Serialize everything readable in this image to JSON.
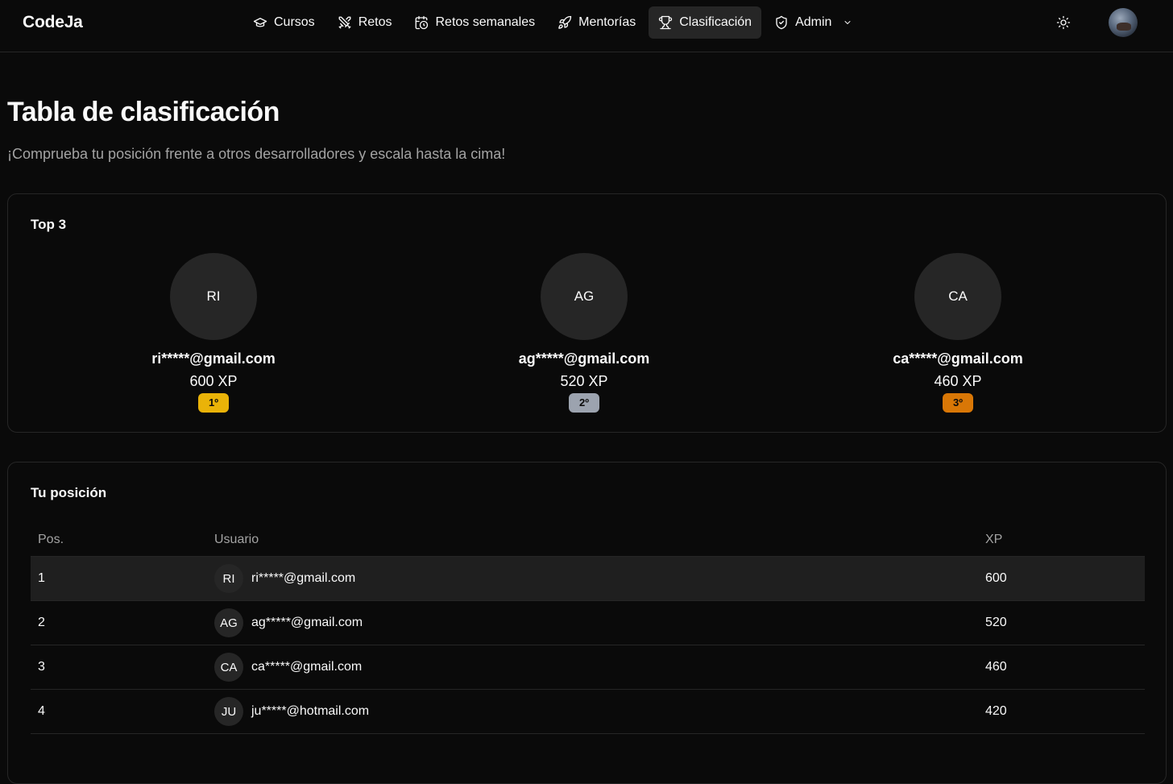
{
  "brand": "CodeJa",
  "nav": {
    "items": [
      {
        "label": "Cursos",
        "icon": "graduation-cap-icon"
      },
      {
        "label": "Retos",
        "icon": "swords-icon"
      },
      {
        "label": "Retos semanales",
        "icon": "calendar-clock-icon"
      },
      {
        "label": "Mentorías",
        "icon": "rocket-icon"
      },
      {
        "label": "Clasificación",
        "icon": "trophy-icon",
        "active": true
      },
      {
        "label": "Admin",
        "icon": "shield-icon",
        "dropdown": true
      }
    ]
  },
  "header": {
    "theme_toggle_icon": "sun-icon"
  },
  "page": {
    "title": "Tabla de clasificación",
    "subtitle": "¡Comprueba tu posición frente a otros desarrolladores y escala hasta la cima!"
  },
  "top3": {
    "title": "Top 3",
    "entries": [
      {
        "initials": "RI",
        "email": "ri*****@gmail.com",
        "xp": "600 XP",
        "rank": "1º",
        "color": "#eab308"
      },
      {
        "initials": "AG",
        "email": "ag*****@gmail.com",
        "xp": "520 XP",
        "rank": "2º",
        "color": "#9ca3af"
      },
      {
        "initials": "CA",
        "email": "ca*****@gmail.com",
        "xp": "460 XP",
        "rank": "3º",
        "color": "#d97706"
      }
    ]
  },
  "ranking": {
    "title": "Tu posición",
    "columns": {
      "pos": "Pos.",
      "user": "Usuario",
      "xp": "XP"
    },
    "rows": [
      {
        "pos": "1",
        "initials": "RI",
        "email": "ri*****@gmail.com",
        "xp": "600"
      },
      {
        "pos": "2",
        "initials": "AG",
        "email": "ag*****@gmail.com",
        "xp": "520"
      },
      {
        "pos": "3",
        "initials": "CA",
        "email": "ca*****@gmail.com",
        "xp": "460"
      },
      {
        "pos": "4",
        "initials": "JU",
        "email": "ju*****@hotmail.com",
        "xp": "420"
      }
    ]
  }
}
